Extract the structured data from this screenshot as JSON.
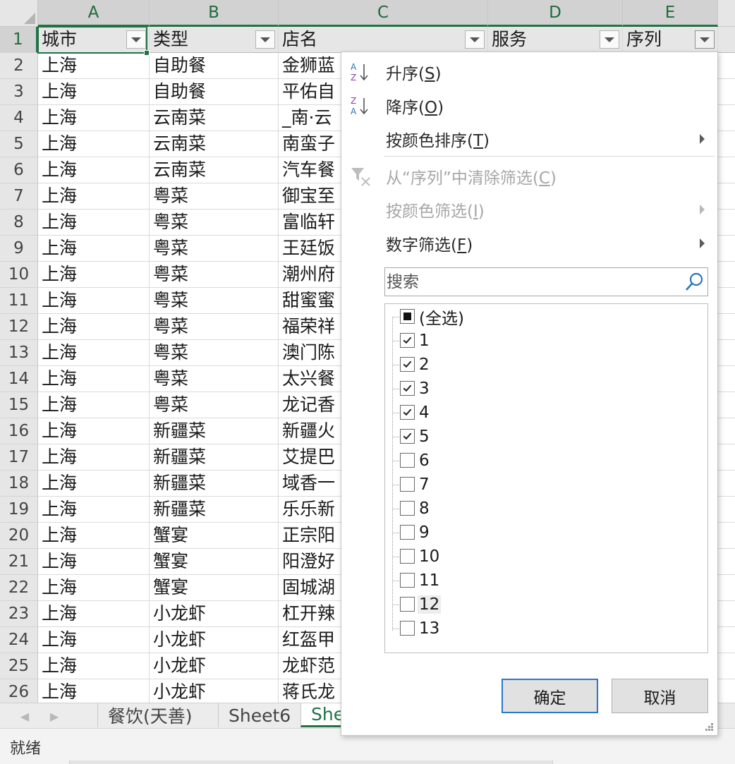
{
  "columns": [
    "A",
    "B",
    "C",
    "D",
    "E"
  ],
  "header_row": [
    "城市",
    "类型",
    "店名",
    "服务",
    "序列"
  ],
  "rows": [
    {
      "n": "2",
      "city": "上海",
      "type": "自助餐",
      "name": "金狮蓝"
    },
    {
      "n": "3",
      "city": "上海",
      "type": "自助餐",
      "name": "平佑自"
    },
    {
      "n": "4",
      "city": "上海",
      "type": "云南菜",
      "name": "_南·云"
    },
    {
      "n": "5",
      "city": "上海",
      "type": "云南菜",
      "name": "南蛮子"
    },
    {
      "n": "6",
      "city": "上海",
      "type": "云南菜",
      "name": "汽车餐"
    },
    {
      "n": "7",
      "city": "上海",
      "type": "粤菜",
      "name": "御宝至"
    },
    {
      "n": "8",
      "city": "上海",
      "type": "粤菜",
      "name": "富临轩"
    },
    {
      "n": "9",
      "city": "上海",
      "type": "粤菜",
      "name": "王廷饭"
    },
    {
      "n": "10",
      "city": "上海",
      "type": "粤菜",
      "name": "潮州府"
    },
    {
      "n": "11",
      "city": "上海",
      "type": "粤菜",
      "name": "甜蜜蜜"
    },
    {
      "n": "12",
      "city": "上海",
      "type": "粤菜",
      "name": "福荣祥"
    },
    {
      "n": "13",
      "city": "上海",
      "type": "粤菜",
      "name": "澳门陈"
    },
    {
      "n": "14",
      "city": "上海",
      "type": "粤菜",
      "name": "太兴餐"
    },
    {
      "n": "15",
      "city": "上海",
      "type": "粤菜",
      "name": "龙记香"
    },
    {
      "n": "16",
      "city": "上海",
      "type": "新疆菜",
      "name": "新疆火"
    },
    {
      "n": "17",
      "city": "上海",
      "type": "新疆菜",
      "name": "艾提巴"
    },
    {
      "n": "18",
      "city": "上海",
      "type": "新疆菜",
      "name": "域香一"
    },
    {
      "n": "19",
      "city": "上海",
      "type": "新疆菜",
      "name": "乐乐新"
    },
    {
      "n": "20",
      "city": "上海",
      "type": "蟹宴",
      "name": "正宗阳"
    },
    {
      "n": "21",
      "city": "上海",
      "type": "蟹宴",
      "name": "阳澄好"
    },
    {
      "n": "22",
      "city": "上海",
      "type": "蟹宴",
      "name": "固城湖"
    },
    {
      "n": "23",
      "city": "上海",
      "type": "小龙虾",
      "name": "杠开辣"
    },
    {
      "n": "24",
      "city": "上海",
      "type": "小龙虾",
      "name": "红盔甲"
    },
    {
      "n": "25",
      "city": "上海",
      "type": "小龙虾",
      "name": "龙虾范"
    },
    {
      "n": "26",
      "city": "上海",
      "type": "小龙虾",
      "name": "蒋氏龙"
    }
  ],
  "sheet_tabs": [
    "餐饮(天善)",
    "Sheet6",
    "She"
  ],
  "status": {
    "ready": "就绪"
  },
  "filter_menu": {
    "sort_asc": {
      "text": "升序(",
      "key": "S",
      "end": ")"
    },
    "sort_desc": {
      "text": "降序(",
      "key": "O",
      "end": ")"
    },
    "sort_color": {
      "text": "按颜色排序(",
      "key": "T",
      "end": ")"
    },
    "clear_filter": {
      "text": "从“序列”中清除筛选(",
      "key": "C",
      "end": ")"
    },
    "filter_color": {
      "text": "按颜色筛选(",
      "key": "I",
      "end": ")"
    },
    "number_filter": {
      "text": "数字筛选(",
      "key": "F",
      "end": ")"
    },
    "search_placeholder": "搜索",
    "items": [
      {
        "label": "(全选)",
        "state": "partial"
      },
      {
        "label": "1",
        "state": "checked"
      },
      {
        "label": "2",
        "state": "checked"
      },
      {
        "label": "3",
        "state": "checked"
      },
      {
        "label": "4",
        "state": "checked"
      },
      {
        "label": "5",
        "state": "checked"
      },
      {
        "label": "6",
        "state": "unchecked"
      },
      {
        "label": "7",
        "state": "unchecked"
      },
      {
        "label": "8",
        "state": "unchecked"
      },
      {
        "label": "9",
        "state": "unchecked"
      },
      {
        "label": "10",
        "state": "unchecked"
      },
      {
        "label": "11",
        "state": "unchecked"
      },
      {
        "label": "12",
        "state": "unchecked"
      },
      {
        "label": "13",
        "state": "unchecked"
      }
    ],
    "ok": "确定",
    "cancel": "取消"
  },
  "colors": {
    "accent": "#217346",
    "button_focus": "#2a78c8"
  }
}
